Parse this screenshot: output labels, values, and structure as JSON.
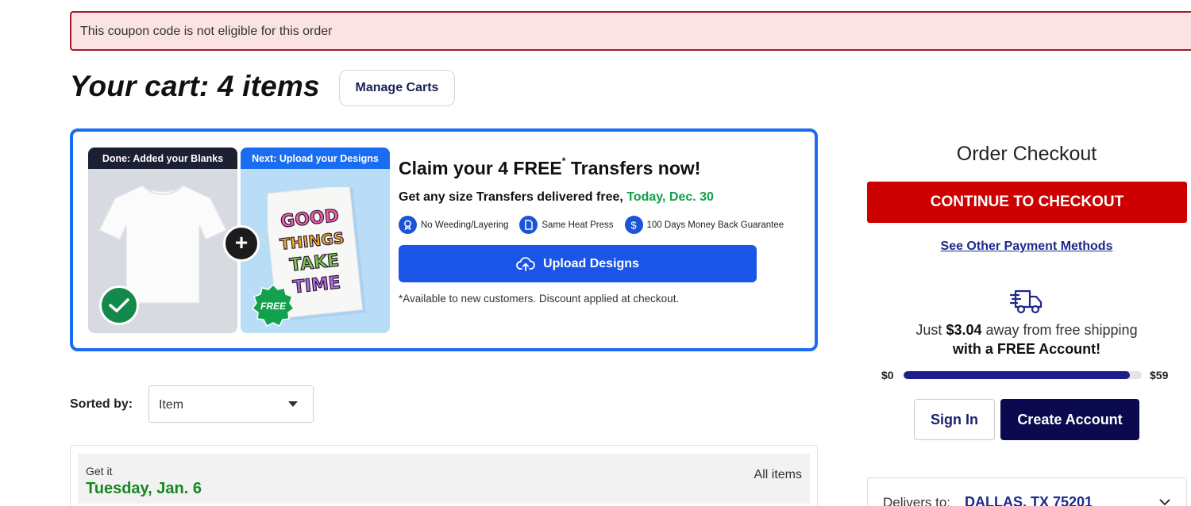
{
  "alert": {
    "message": "This coupon code is not eligible for this order"
  },
  "cart": {
    "title": "Your cart: 4 items",
    "manage_label": "Manage Carts"
  },
  "promo": {
    "blank_header": "Done: Added your Blanks",
    "design_header": "Next: Upload your Designs",
    "title": "Claim your 4 FREE",
    "title_sup": "*",
    "title_suffix": " Transfers now!",
    "subtitle": "Get any size Transfers delivered free, ",
    "subtitle_date": "Today, Dec. 30",
    "features": [
      {
        "icon": "ribbon-icon",
        "label": "No Weeding/Layering"
      },
      {
        "icon": "document-icon",
        "label": "Same Heat Press"
      },
      {
        "icon": "dollar-icon",
        "label": "100 Days Money Back Guarantee"
      }
    ],
    "upload_label": "Upload Designs",
    "note": "*Available to new customers. Discount applied at checkout.",
    "free_badge": "FREE",
    "plus": "+",
    "poster_text": [
      "GOOD",
      "THINGS",
      "TAKE",
      "TIME"
    ]
  },
  "sort": {
    "label": "Sorted by:",
    "value": "Item"
  },
  "delivery_group": {
    "label": "Get it",
    "date": "Tuesday, Jan. 6",
    "all_items": "All items"
  },
  "checkout": {
    "title": "Order Checkout",
    "continue_label": "CONTINUE TO CHECKOUT",
    "other_methods": "See Other Payment Methods",
    "ship_prefix": "Just ",
    "ship_amount": "$3.04",
    "ship_suffix": " away from free shipping",
    "ship_line2": "with a FREE Account!",
    "progress_min": "$0",
    "progress_max": "$59",
    "progress_percent": 95,
    "signin_label": "Sign In",
    "create_label": "Create Account",
    "deliver_label": "Delivers to:",
    "deliver_location": "DALLAS, TX 75201"
  },
  "colors": {
    "accent_blue": "#1a6cf0",
    "checkout_red": "#cc0000",
    "navy": "#0b0a4e",
    "green_date": "#16871f"
  }
}
